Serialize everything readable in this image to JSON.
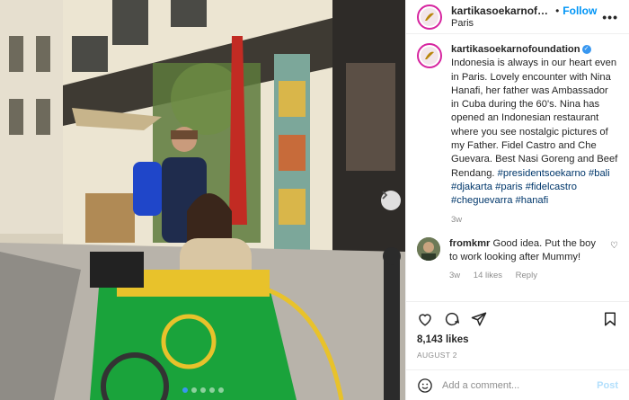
{
  "post": {
    "header": {
      "username": "kartikasoekarnofoundation",
      "separator": "•",
      "follow_label": "Follow",
      "location": "Paris",
      "more_label": "•••"
    },
    "caption": {
      "username": "kartikasoekarnofoundation",
      "verified_icon": "check-icon",
      "text": "Indonesia is always in our heart even in Paris. Lovely encounter with Nina Hanafi, her father was Ambassador in Cuba during the 60's. Nina has opened an Indonesian restaurant where you see nostalgic pictures of my Father. Fidel Castro and Che Guevara. Best Nasi Goreng and Beef Rendang.",
      "hashtags": "#presidentsoekarno #bali #djakarta #paris #fidelcastro #cheguevarra #hanafi",
      "time": "3w"
    },
    "comments": [
      {
        "username": "fromkmr",
        "text": "Good idea. Put the boy to work looking after Mummy!",
        "time": "3w",
        "likes": "14 likes",
        "reply_label": "Reply"
      }
    ],
    "likes": "8,143 likes",
    "date": "AUGUST 2",
    "add_comment": {
      "placeholder": "Add a comment...",
      "post_label": "Post"
    },
    "carousel": {
      "total": 5,
      "active": 0
    }
  },
  "colors": {
    "accent": "#0095f6",
    "post_disabled": "#b2dffc",
    "text": "#262626",
    "muted": "#8e8e8e",
    "hashtag": "#00376b"
  }
}
